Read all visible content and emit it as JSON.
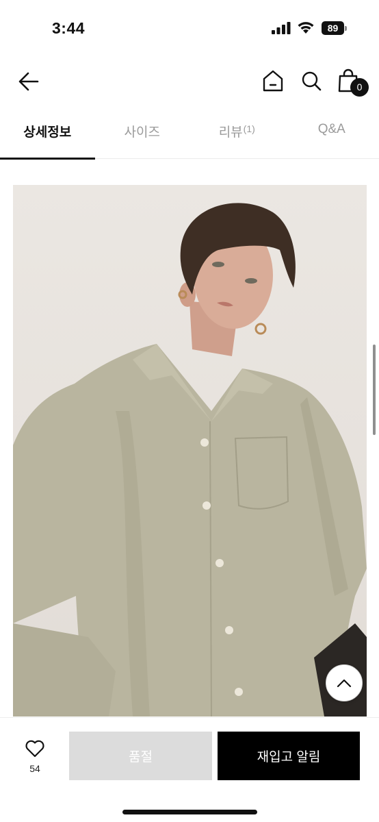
{
  "status_bar": {
    "time": "3:44",
    "battery": "89"
  },
  "header": {
    "cart_count": "0",
    "icons": [
      "back-arrow-icon",
      "home-icon",
      "search-icon",
      "shopping-bag-icon"
    ]
  },
  "tabs": [
    {
      "label": "상세정보",
      "count": "",
      "active": true
    },
    {
      "label": "사이즈",
      "count": "",
      "active": false
    },
    {
      "label": "리뷰",
      "count": "(1)",
      "active": false
    },
    {
      "label": "Q&A",
      "count": "",
      "active": false
    }
  ],
  "product": {
    "image_colors": {
      "background": "#e8e3de",
      "shirt": "#b9b59f",
      "hair": "#3e2e24",
      "skin": "#d9ac98"
    }
  },
  "bottom_bar": {
    "like_count": "54",
    "soldout_label": "품절",
    "restock_label": "재입고 알림",
    "colors": {
      "soldout_bg": "#dcdcdc",
      "restock_bg": "#000000"
    }
  }
}
